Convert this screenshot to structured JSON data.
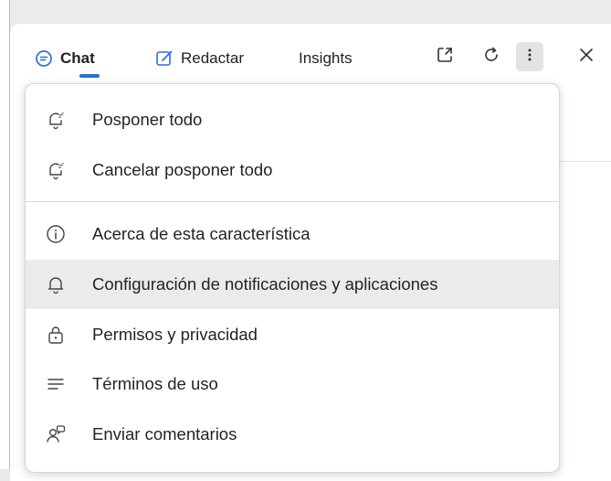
{
  "toolbar": {
    "tabs": [
      {
        "label": "Chat",
        "icon": "chat-bubble-icon",
        "active": true
      },
      {
        "label": "Redactar",
        "icon": "compose-icon",
        "active": false
      },
      {
        "label": "Insights",
        "icon": "",
        "active": false
      }
    ],
    "buttons": [
      "popout-icon",
      "refresh-icon",
      "more-vertical-icon",
      "close-icon"
    ]
  },
  "menu": {
    "items": [
      {
        "label": "Posponer todo",
        "icon": "snooze-icon"
      },
      {
        "label": "Cancelar posponer todo",
        "icon": "unsnooze-icon"
      },
      {
        "label": "Acerca de esta característica",
        "icon": "info-icon"
      },
      {
        "label": "Configuración de notificaciones y aplicaciones",
        "icon": "bell-icon",
        "highlighted": true
      },
      {
        "label": "Permisos y privacidad",
        "icon": "lock-icon"
      },
      {
        "label": "Términos de uso",
        "icon": "lines-icon"
      },
      {
        "label": "Enviar comentarios",
        "icon": "feedback-icon"
      }
    ]
  },
  "colors": {
    "accent": "#2a6fd6",
    "menu_hover": "#ebebeb",
    "background": "#e9e9e9"
  }
}
